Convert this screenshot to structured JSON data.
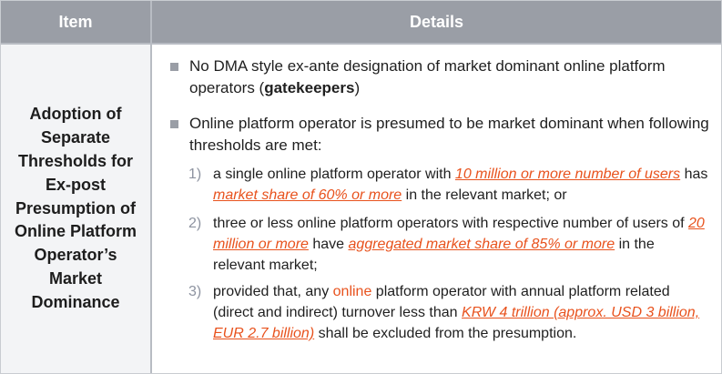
{
  "header": {
    "item": "Item",
    "details": "Details"
  },
  "item_title": "Adoption of Separate Thresholds for Ex-post Presumption of Online Platform Operator’s Market Dominance",
  "bullets": {
    "b1_part1": "No DMA style ex-ante designation of market dominant online platform operators (",
    "b1_bold": "gatekeepers",
    "b1_part2": ")",
    "b2": "Online platform operator is presumed to be market dominant when following thresholds are met:"
  },
  "items": [
    {
      "num": "1)",
      "t1": "a single online platform operator with ",
      "h1": "10 million or more number of users",
      "t2": " has ",
      "h2": "market share of 60% or more",
      "t3": " in the relevant market; or"
    },
    {
      "num": "2)",
      "t1": "three or less online platform operators with respective number of users of ",
      "h1": "20 million or more",
      "t2": " have ",
      "h2": "aggregated market share of 85% or more",
      "t3": " in the relevant market;"
    },
    {
      "num": "3)",
      "t1": "provided that, any ",
      "o1": "online",
      "t2": " platform operator with annual platform related (direct and indirect) turnover less than ",
      "h1": "KRW 4 trillion (approx. USD 3 billion, EUR 2.7 billion)",
      "t3": " shall be excluded from the presumption."
    }
  ],
  "colors": {
    "header_bg": "#9a9ea6",
    "left_cell_bg": "#f3f4f6",
    "highlight": "#e8521d",
    "bullet_square": "#9a9ea6"
  }
}
